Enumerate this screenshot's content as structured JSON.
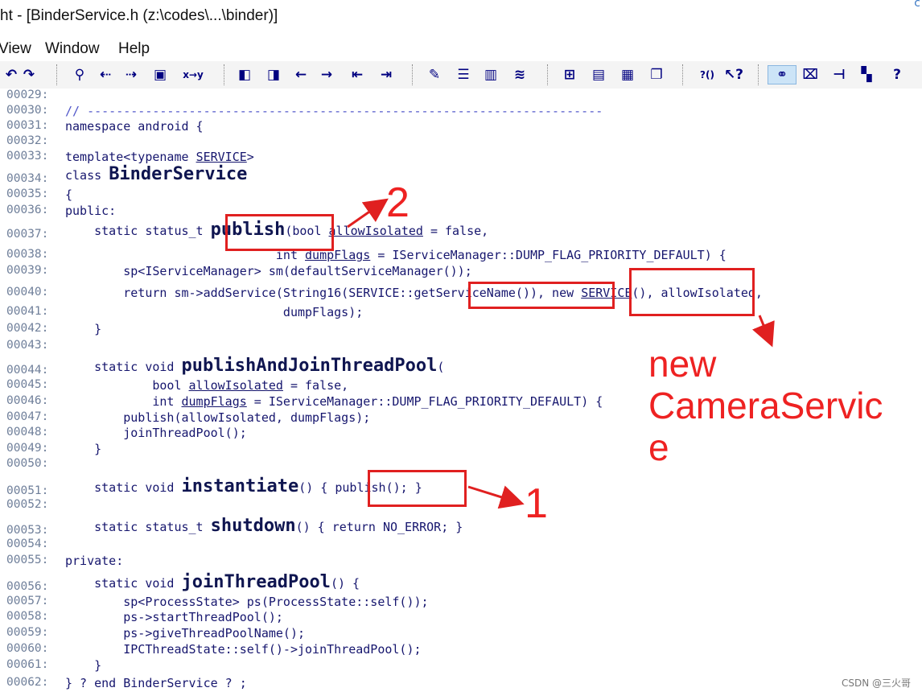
{
  "window": {
    "title": "ht - [BinderService.h (z:\\codes\\...\\binder)]",
    "corner_glyph": "c"
  },
  "menu": {
    "items": [
      "View",
      "Window",
      "Help"
    ]
  },
  "toolbar": {
    "buttons": [
      {
        "id": "undo-icon",
        "glyph": "↶"
      },
      {
        "id": "redo-icon",
        "glyph": "↷"
      },
      {
        "id": "find-icon",
        "glyph": "⚲"
      },
      {
        "id": "find-prev-icon",
        "glyph": "⇠"
      },
      {
        "id": "find-next-icon",
        "glyph": "⇢"
      },
      {
        "id": "find-files-icon",
        "glyph": "▣"
      },
      {
        "id": "replace-icon",
        "glyph": "x→y"
      },
      {
        "id": "bookmark-prev-icon",
        "glyph": "◧"
      },
      {
        "id": "bookmark-next-icon",
        "glyph": "◨"
      },
      {
        "id": "back-icon",
        "glyph": "←"
      },
      {
        "id": "forward-icon",
        "glyph": "→"
      },
      {
        "id": "indent-left-icon",
        "glyph": "⇤"
      },
      {
        "id": "indent-right-icon",
        "glyph": "⇥"
      },
      {
        "id": "symbol-icon",
        "glyph": "✎"
      },
      {
        "id": "context-icon",
        "glyph": "☰"
      },
      {
        "id": "book-icon",
        "glyph": "▥"
      },
      {
        "id": "relation-icon",
        "glyph": "≋"
      },
      {
        "id": "layout-1-icon",
        "glyph": "⊞"
      },
      {
        "id": "layout-2-icon",
        "glyph": "▤"
      },
      {
        "id": "layout-3-icon",
        "glyph": "▦"
      },
      {
        "id": "layout-4-icon",
        "glyph": "❐"
      },
      {
        "id": "help-context-icon",
        "glyph": "?()"
      },
      {
        "id": "help-cursor-icon",
        "glyph": "↖?"
      },
      {
        "id": "activate-icon",
        "glyph": "⚭"
      },
      {
        "id": "zoom-icon",
        "glyph": "⌧"
      },
      {
        "id": "tree-icon",
        "glyph": "⊣"
      },
      {
        "id": "graph-icon",
        "glyph": "▚"
      },
      {
        "id": "help-icon",
        "glyph": "?"
      }
    ]
  },
  "code": {
    "line_numbers": [
      "00029:",
      "00030:",
      "00031:",
      "00032:",
      "00033:",
      "00034:",
      "00035:",
      "00036:",
      "00037:",
      "00038:",
      "00039:",
      "00040:",
      "00041:",
      "00042:",
      "00043:",
      "00044:",
      "00045:",
      "00046:",
      "00047:",
      "00048:",
      "00049:",
      "00050:",
      "00051:",
      "00052:",
      "00053:",
      "00054:",
      "00055:",
      "00056:",
      "00057:",
      "00058:",
      "00059:",
      "00060:",
      "00061:",
      "00062:"
    ],
    "lines": [
      {
        "segments": []
      },
      {
        "segments": [
          {
            "t": "// -----------------------------------------------------------------------",
            "c": "cm"
          }
        ]
      },
      {
        "segments": [
          {
            "t": "namespace android {"
          }
        ]
      },
      {
        "segments": []
      },
      {
        "segments": [
          {
            "t": "template<typename "
          },
          {
            "t": "SERVICE",
            "u": true
          },
          {
            "t": ">"
          }
        ]
      },
      {
        "segments": [
          {
            "t": "class "
          },
          {
            "t": "BinderService",
            "b": true
          }
        ]
      },
      {
        "segments": [
          {
            "t": "{"
          }
        ]
      },
      {
        "segments": [
          {
            "t": "public:"
          }
        ]
      },
      {
        "segments": [
          {
            "t": "    static status_t "
          },
          {
            "t": "publish",
            "b": true
          },
          {
            "t": "(bool "
          },
          {
            "t": "allowIsolated",
            "u": true
          },
          {
            "t": " = false,"
          }
        ]
      },
      {
        "segments": [
          {
            "t": "                             int "
          },
          {
            "t": "dumpFlags",
            "u": true
          },
          {
            "t": " = IServiceManager::DUMP_FLAG_PRIORITY_DEFAULT) {"
          }
        ]
      },
      {
        "segments": [
          {
            "t": "        sp<IServiceManager> sm(defaultServiceManager());"
          }
        ]
      },
      {
        "segments": [
          {
            "t": "        return sm->addService(String16(SERVICE::getServiceName()), new "
          },
          {
            "t": "SERVICE",
            "u": true
          },
          {
            "t": "(), allowIsolated,"
          }
        ]
      },
      {
        "segments": [
          {
            "t": "                              dumpFlags);"
          }
        ]
      },
      {
        "segments": [
          {
            "t": "    }"
          }
        ]
      },
      {
        "segments": []
      },
      {
        "segments": [
          {
            "t": "    static void "
          },
          {
            "t": "publishAndJoinThreadPool",
            "b": true
          },
          {
            "t": "("
          }
        ]
      },
      {
        "segments": [
          {
            "t": "            bool "
          },
          {
            "t": "allowIsolated",
            "u": true
          },
          {
            "t": " = false,"
          }
        ]
      },
      {
        "segments": [
          {
            "t": "            int "
          },
          {
            "t": "dumpFlags",
            "u": true
          },
          {
            "t": " = IServiceManager::DUMP_FLAG_PRIORITY_DEFAULT) {"
          }
        ]
      },
      {
        "segments": [
          {
            "t": "        publish(allowIsolated, dumpFlags);"
          }
        ]
      },
      {
        "segments": [
          {
            "t": "        joinThreadPool();"
          }
        ]
      },
      {
        "segments": [
          {
            "t": "    }"
          }
        ]
      },
      {
        "segments": []
      },
      {
        "segments": [
          {
            "t": "    static void "
          },
          {
            "t": "instantiate",
            "b": true
          },
          {
            "t": "() { publish(); }"
          }
        ]
      },
      {
        "segments": []
      },
      {
        "segments": [
          {
            "t": "    static status_t "
          },
          {
            "t": "shutdown",
            "b": true
          },
          {
            "t": "() { return NO_ERROR; }"
          }
        ]
      },
      {
        "segments": []
      },
      {
        "segments": [
          {
            "t": "private:"
          }
        ]
      },
      {
        "segments": [
          {
            "t": "    static void "
          },
          {
            "t": "joinThreadPool",
            "b": true
          },
          {
            "t": "() {"
          }
        ]
      },
      {
        "segments": [
          {
            "t": "        sp<ProcessState> ps(ProcessState::self());"
          }
        ]
      },
      {
        "segments": [
          {
            "t": "        ps->startThreadPool();"
          }
        ]
      },
      {
        "segments": [
          {
            "t": "        ps->giveThreadPoolName();"
          }
        ]
      },
      {
        "segments": [
          {
            "t": "        IPCThreadState::self()->joinThreadPool();"
          }
        ]
      },
      {
        "segments": [
          {
            "t": "    }"
          }
        ]
      },
      {
        "segments": [
          {
            "t": "} ? end BinderService ? ;"
          }
        ]
      }
    ]
  },
  "annotations": {
    "label_1": "1",
    "label_2": "2",
    "note_lines": [
      "new",
      "CameraServic",
      "e"
    ],
    "color": "#e02020"
  },
  "watermark": "CSDN @三火哥"
}
